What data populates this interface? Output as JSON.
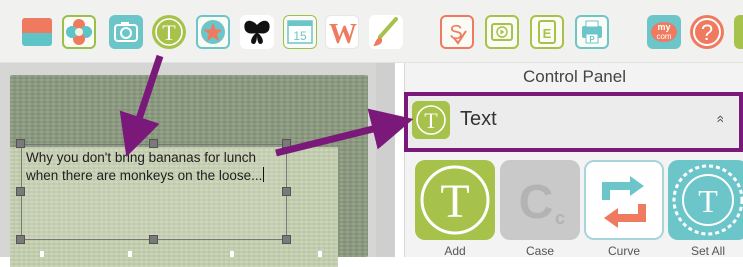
{
  "toolbar": {
    "buttons": [
      {
        "name": "layout-icon",
        "label": ""
      },
      {
        "name": "flower-embellishment-icon",
        "label": ""
      },
      {
        "name": "camera-photo-icon",
        "label": ""
      },
      {
        "name": "text-icon",
        "label": "T"
      },
      {
        "name": "star-shape-icon",
        "label": ""
      },
      {
        "name": "butterfly-icon",
        "label": ""
      },
      {
        "name": "calendar-icon",
        "label": "15"
      },
      {
        "name": "wordart-icon",
        "label": "W"
      },
      {
        "name": "brush-icon",
        "label": ""
      },
      {
        "name": "save-icon",
        "label": "S"
      },
      {
        "name": "slideshow-icon",
        "label": ""
      },
      {
        "name": "edit-icon",
        "label": "E"
      },
      {
        "name": "print-icon",
        "label": "P"
      },
      {
        "name": "mycom-icon",
        "label_top": "my",
        "label_bottom": "com"
      },
      {
        "name": "help-icon",
        "label": "?"
      }
    ]
  },
  "canvas": {
    "textbox_text": "Why you don't bring bananas for lunch when there are monkeys on the loose..."
  },
  "control_panel": {
    "title": "Control Panel",
    "section": {
      "title": "Text",
      "icon_label": "T",
      "chevron": "»"
    },
    "tools": [
      {
        "label": "Add",
        "glyph": "T"
      },
      {
        "label": "Case",
        "glyph": "C"
      },
      {
        "label": "Curve",
        "glyph": ""
      },
      {
        "label": "Set All",
        "glyph": "T"
      }
    ]
  },
  "colors": {
    "annotation_purple": "#7a197a",
    "icon_green": "#a6c24a",
    "icon_salmon": "#ee7a5d",
    "icon_teal": "#6cc6c9"
  }
}
